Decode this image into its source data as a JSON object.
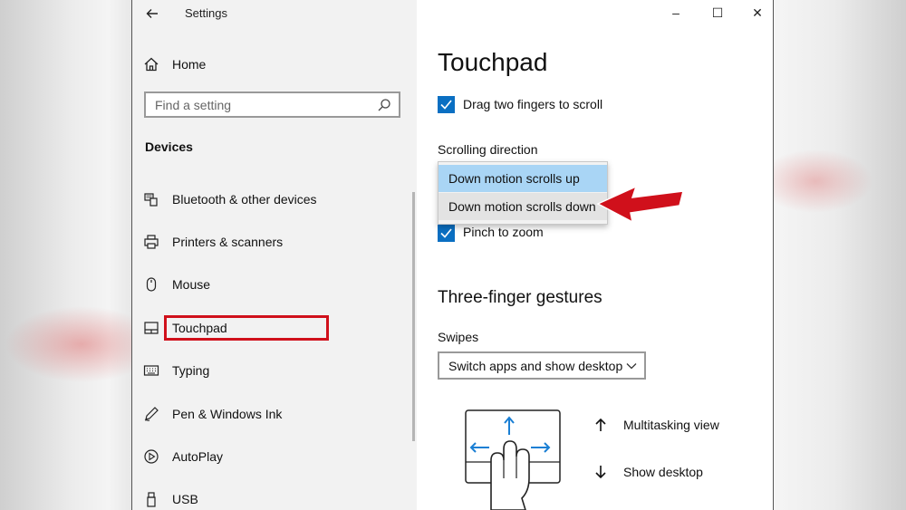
{
  "window": {
    "title": "Settings",
    "controls": {
      "minimize": "–",
      "maximize": "☐",
      "close": "✕"
    }
  },
  "sidebar": {
    "home_label": "Home",
    "search_placeholder": "Find a setting",
    "section_title": "Devices",
    "items": [
      {
        "label": "Bluetooth & other devices",
        "icon": "bluetooth-devices-icon"
      },
      {
        "label": "Printers & scanners",
        "icon": "printer-icon"
      },
      {
        "label": "Mouse",
        "icon": "mouse-icon"
      },
      {
        "label": "Touchpad",
        "icon": "touchpad-icon",
        "selected": true
      },
      {
        "label": "Typing",
        "icon": "keyboard-icon"
      },
      {
        "label": "Pen & Windows Ink",
        "icon": "pen-icon"
      },
      {
        "label": "AutoPlay",
        "icon": "autoplay-icon"
      },
      {
        "label": "USB",
        "icon": "usb-icon"
      }
    ]
  },
  "main": {
    "title": "Touchpad",
    "drag_two_fingers": {
      "label": "Drag two fingers to scroll",
      "checked": true
    },
    "scrolling_direction": {
      "label": "Scrolling direction",
      "options": [
        "Down motion scrolls up",
        "Down motion scrolls down"
      ],
      "selected": "Down motion scrolls up",
      "hovered": "Down motion scrolls down"
    },
    "pinch_to_zoom": {
      "label": "Pinch to zoom",
      "checked": true
    },
    "three_finger": {
      "title": "Three-finger gestures",
      "swipes_label": "Swipes",
      "swipes_value": "Switch apps and show desktop",
      "gestures": [
        {
          "direction": "up",
          "label": "Multitasking view"
        },
        {
          "direction": "down",
          "label": "Show desktop"
        }
      ]
    }
  },
  "colors": {
    "accent": "#0a6fc2",
    "highlight_red": "#d0101b",
    "dropdown_selected": "#a9d5f5"
  }
}
